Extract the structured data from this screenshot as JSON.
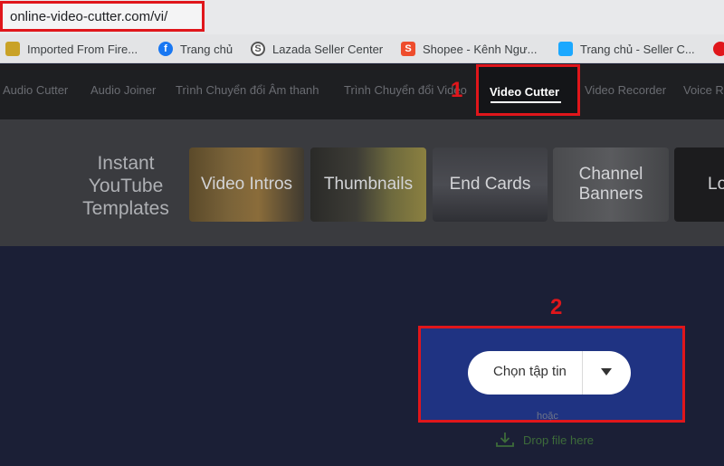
{
  "browser": {
    "url": "online-video-cutter.com/vi/"
  },
  "bookmarks": [
    {
      "label": "Imported From Fire...",
      "icon": "folder-icon"
    },
    {
      "label": "Trang chủ",
      "icon": "facebook-icon"
    },
    {
      "label": "Lazada Seller Center",
      "icon": "lazada-icon"
    },
    {
      "label": "Shopee - Kênh Ngư...",
      "icon": "shopee-icon"
    },
    {
      "label": "Trang chủ - Seller C...",
      "icon": "tiki-icon"
    }
  ],
  "nav": {
    "items": [
      "Audio Cutter",
      "Audio Joiner",
      "Trình Chuyển đổi Âm thanh",
      "Trình Chuyển đổi Video",
      "Video Recorder",
      "Voice R"
    ],
    "active": "Video Cutter"
  },
  "annotations": {
    "step1": "1",
    "step2": "2"
  },
  "templates": {
    "heading": "Instant YouTube Templates",
    "tiles": [
      "Video Intros",
      "Thumbnails",
      "End Cards",
      "Channel Banners",
      "Lo"
    ]
  },
  "upload": {
    "choose_label": "Chọn tập tin",
    "or_label": "hoặc",
    "drop_label": "Drop file here"
  },
  "colors": {
    "highlight": "#e0161b",
    "upload_bg": "#1f3382",
    "main_bg": "#1b1f36",
    "nav_bg": "#1e1f22"
  }
}
